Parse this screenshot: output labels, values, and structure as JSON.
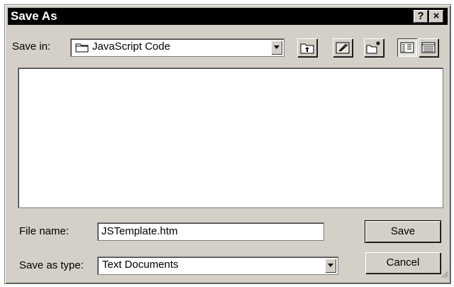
{
  "window": {
    "title": "Save As",
    "help_label": "?",
    "close_label": "×"
  },
  "toolbar": {
    "save_in_label": "Save in:",
    "save_in_value": "JavaScript Code",
    "icons": [
      "up-one-level-icon",
      "desktop-icon",
      "new-folder-icon",
      "list-view-icon",
      "details-view-icon"
    ]
  },
  "form": {
    "file_name_label": "File name:",
    "file_name_value": "JSTemplate.htm",
    "save_as_type_label": "Save as type:",
    "save_as_type_value": "Text Documents"
  },
  "buttons": {
    "save_label": "Save",
    "cancel_label": "Cancel"
  }
}
